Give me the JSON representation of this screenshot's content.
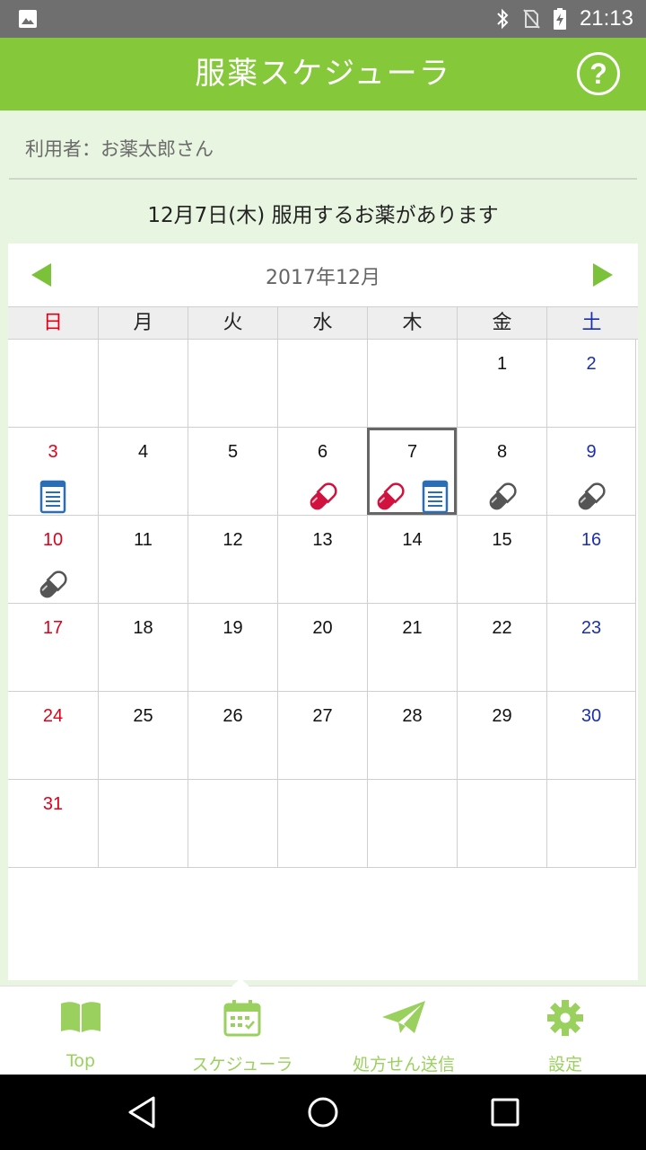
{
  "status": {
    "time": "21:13"
  },
  "header": {
    "title": "服薬スケジューラ",
    "help": "?"
  },
  "user": {
    "label": "利用者：お薬太郎さん"
  },
  "notice": "12月7日(木) 服用するお薬があります",
  "calendar": {
    "month_label": "2017年12月",
    "weekdays": [
      "日",
      "月",
      "火",
      "水",
      "木",
      "金",
      "土"
    ],
    "weeks": [
      [
        "",
        "",
        "",
        "",
        "",
        "1",
        "2"
      ],
      [
        "3",
        "4",
        "5",
        "6",
        "7",
        "8",
        "9"
      ],
      [
        "10",
        "11",
        "12",
        "13",
        "14",
        "15",
        "16"
      ],
      [
        "17",
        "18",
        "19",
        "20",
        "21",
        "22",
        "23"
      ],
      [
        "24",
        "25",
        "26",
        "27",
        "28",
        "29",
        "30"
      ],
      [
        "31",
        "",
        "",
        "",
        "",
        "",
        ""
      ]
    ],
    "today": "7",
    "colors": {
      "sunday": "#e0001a",
      "saturday": "#1a2fb0",
      "pill_active": "#d1123e",
      "pill_done": "#555555",
      "doc": "#2a6fb5",
      "accent": "#85c83a"
    },
    "events": {
      "3": [
        "document-icon"
      ],
      "6": [
        "pill-red-icon"
      ],
      "7": [
        "pill-red-icon",
        "document-icon"
      ],
      "8": [
        "pill-gray-icon"
      ],
      "9": [
        "pill-gray-icon"
      ],
      "10": [
        "pill-gray-icon"
      ]
    }
  },
  "nav": {
    "tabs": [
      {
        "label": "Top",
        "icon": "book-icon"
      },
      {
        "label": "スケジューラ",
        "icon": "calendar-icon",
        "active": true
      },
      {
        "label": "処方せん送信",
        "icon": "paper-plane-icon"
      },
      {
        "label": "設定",
        "icon": "gear-icon"
      }
    ]
  }
}
